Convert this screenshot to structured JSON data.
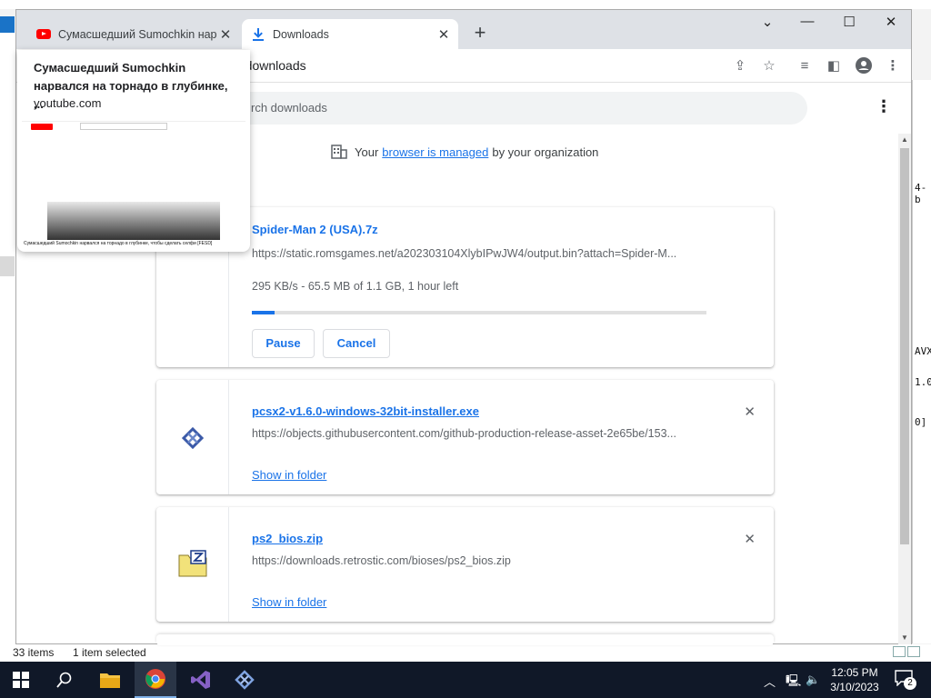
{
  "explorer": {
    "status_items": "33 items",
    "status_selected": "1 item selected",
    "right_fragments": [
      "4-b",
      "AVX",
      "1.0",
      "0]"
    ]
  },
  "browser": {
    "tabs": [
      {
        "label": "Сумасшедший Sumochkin нарвался на торнадо в глубинке, чтобы сделать селфи [FESD]",
        "favicon": "youtube-icon"
      },
      {
        "label": "Downloads",
        "favicon": "download-icon"
      }
    ],
    "url": "://downloads",
    "hover_card": {
      "title": "Сумасшедший Sumochkin нарвался на торнадо в глубинке, ...",
      "domain": "youtube.com",
      "preview_caption": "Сумасшедший Sumochkin нарвался на торнадо в глубинке, чтобы сделать селфи [FESD]"
    }
  },
  "downloads": {
    "search_placeholder": "rch downloads",
    "managed_prefix": "Your",
    "managed_link": "browser is managed",
    "managed_suffix": "by your organization",
    "items": [
      {
        "name": "Spider-Man 2 (USA).7z",
        "url": "https://static.romsgames.net/a202303104XlybIPwJW4/output.bin?attach=Spider-M...",
        "status": "295 KB/s - 65.5 MB of 1.1 GB, 1 hour left",
        "progress": 0.05,
        "pause_label": "Pause",
        "cancel_label": "Cancel"
      },
      {
        "name": "pcsx2-v1.6.0-windows-32bit-installer.exe",
        "url": "https://objects.githubusercontent.com/github-production-release-asset-2e65be/153...",
        "show_folder": "Show in folder"
      },
      {
        "name": "ps2_bios.zip",
        "url": "https://downloads.retrostic.com/bioses/ps2_bios.zip",
        "show_folder": "Show in folder"
      }
    ]
  },
  "taskbar": {
    "time": "12:05 PM",
    "date": "3/10/2023",
    "notification_count": "2"
  },
  "colors": {
    "accent": "#1a73e8",
    "tabstrip": "#dee1e6",
    "taskbar": "#101828"
  }
}
